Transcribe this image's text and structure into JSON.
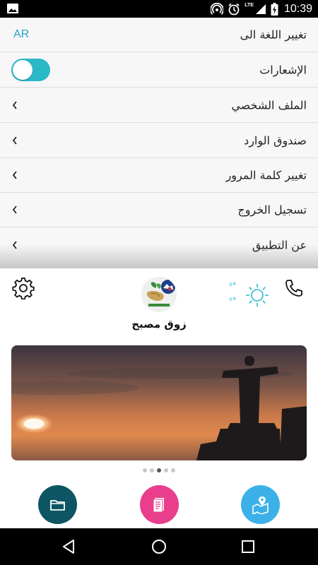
{
  "status_bar": {
    "time": "10:39",
    "network": "LTE",
    "icons": [
      "image-icon",
      "hotspot-icon",
      "alarm-icon",
      "signal-icon",
      "battery-charging-icon"
    ]
  },
  "settings": {
    "language": {
      "label": "تغيير اللغة الى",
      "value": "AR"
    },
    "notifications": {
      "label": "الإشعارات",
      "enabled": true
    },
    "items": [
      {
        "label": "الملف الشخصي",
        "icon": "chevron-left-icon"
      },
      {
        "label": "صندوق الوارد",
        "icon": "chevron-left-icon"
      },
      {
        "label": "تغيير كلمة المرور",
        "icon": "chevron-left-icon"
      },
      {
        "label": "تسجيل الخروج",
        "icon": "chevron-left-icon"
      },
      {
        "label": "عن التطبيق",
        "icon": "chevron-left-icon"
      }
    ]
  },
  "header": {
    "title": "زوق مصبح",
    "weather": {
      "temp_high": "⁰°",
      "temp_low": "⁰°",
      "icon": "sun-icon"
    },
    "icons": {
      "settings": "gear-icon",
      "call": "phone-icon"
    }
  },
  "carousel": {
    "image": "sunset-statue-photo",
    "page_count": 5,
    "active_index": 2
  },
  "actions": [
    {
      "name": "folder",
      "icon": "folder-icon",
      "color": "#0d5563"
    },
    {
      "name": "document",
      "icon": "document-icon",
      "color": "#e83e8c"
    },
    {
      "name": "map",
      "icon": "map-pin-icon",
      "color": "#3cb0e8"
    }
  ],
  "colors": {
    "accent": "#2bb8c7",
    "link": "#2aa0c8"
  },
  "nav_bar": {
    "icons": [
      "back-icon",
      "home-icon",
      "recents-icon"
    ]
  }
}
